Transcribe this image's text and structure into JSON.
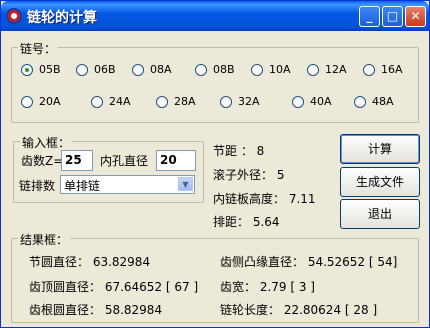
{
  "window": {
    "title": "链轮的计算",
    "min": "_",
    "max": "□",
    "close": "✕"
  },
  "chain_no": {
    "group_label": "链号：",
    "options": [
      "05B",
      "06B",
      "08A",
      "08B",
      "10A",
      "12A",
      "16A",
      "20A",
      "24A",
      "28A",
      "32A",
      "40A",
      "48A"
    ],
    "selected": "05B"
  },
  "input": {
    "group_label": "输入框：",
    "teeth_label": "齿数Z=",
    "teeth_value": "25",
    "bore_label": "内孔直径",
    "bore_value": "20",
    "rows_label": "链排数",
    "rows_value": "单排链"
  },
  "params": {
    "pitch": "节距 ：  8",
    "roller_d": "滚子外径：  5",
    "plate_h": "内链板高度：  7.11",
    "row_pitch": "排距：  5.64"
  },
  "buttons": {
    "calc": "计算",
    "generate": "生成文件",
    "exit": "退出"
  },
  "results": {
    "group_label": "结果框：",
    "pitch_d": "节圆直径：  63.82984",
    "side_d": "齿侧凸缘直径：  54.52652 [ 54]",
    "tip_d": "齿顶圆直径：  67.64652 [ 67 ]",
    "tooth_w": "齿宽：  2.79 [ 3 ]",
    "root_d": "齿根圆直径：  58.82984",
    "chain_len": "链轮长度：  22.80624  [ 28 ]"
  },
  "colors": {
    "titlebar": "#0558e3",
    "face": "#ece9d8",
    "selected_dot": "#21a121"
  }
}
